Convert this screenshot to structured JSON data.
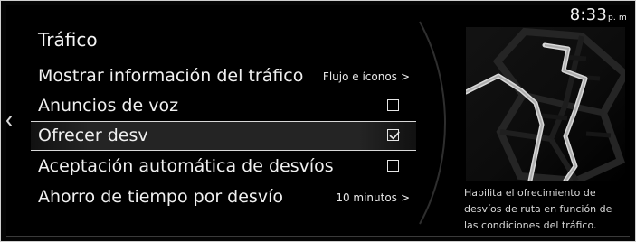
{
  "status": {
    "time": "8:33",
    "am_pm": "p. m"
  },
  "screen": {
    "title": "Tráfico",
    "back_icon": "chevron-left-icon",
    "description": "Habilita el ofrecimiento de\ndesvíos de ruta en función de\nlas condiciones del tráfico.",
    "colors": {
      "background": "#000000",
      "text": "#f0f0f0",
      "selected_highlight": "#242424",
      "border": "#d8d8d8"
    }
  },
  "menu": {
    "items": [
      {
        "label": "Mostrar información del tráfico",
        "value": "Flujo e íconos",
        "type": "value",
        "chevron": ">"
      },
      {
        "label": "Anuncios de voz",
        "type": "checkbox",
        "checked": false
      },
      {
        "label": "Ofrecer desv",
        "type": "checkbox",
        "checked": true,
        "selected": true
      },
      {
        "label": "Aceptación automática de desvíos",
        "type": "checkbox",
        "checked": false
      },
      {
        "label": "Ahorro de tiempo por desvío",
        "value": "10 minutos",
        "type": "value",
        "chevron": ">"
      }
    ]
  },
  "map_preview": {
    "icon": "route-map-icon"
  }
}
